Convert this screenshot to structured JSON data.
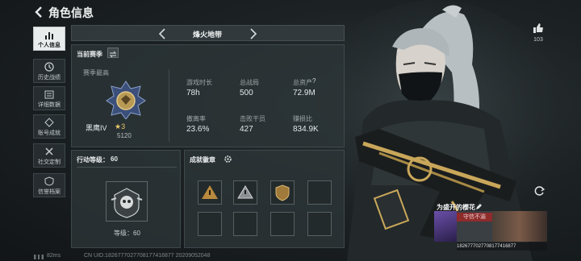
{
  "header": {
    "title": "角色信息"
  },
  "sidebar": {
    "items": [
      {
        "label": "个人信息",
        "icon": "bar-chart-icon",
        "active": true
      },
      {
        "label": "历史战绩",
        "icon": "history-icon"
      },
      {
        "label": "详细数据",
        "icon": "data-list-icon"
      },
      {
        "label": "账号成就",
        "icon": "achievement-icon"
      },
      {
        "label": "社交定制",
        "icon": "tools-icon"
      },
      {
        "label": "信誉档案",
        "icon": "credit-icon"
      }
    ]
  },
  "map_selector": {
    "name": "烽火地带"
  },
  "season": {
    "label": "当前赛季",
    "best_label": "赛季最高",
    "rank_name": "黑鹰IV",
    "rank_stars": "★3",
    "rank_points": "5120",
    "stats": [
      {
        "label": "游戏时长",
        "value": "78h"
      },
      {
        "label": "总战局",
        "value": "500"
      },
      {
        "label": "总资产",
        "value": "72.9M",
        "help": "?"
      },
      {
        "label": "撤离率",
        "value": "23.6%"
      },
      {
        "label": "击败干员",
        "value": "427"
      },
      {
        "label": "赚损比",
        "value": "834.9K"
      }
    ]
  },
  "action_level": {
    "title": "行动等级：",
    "level": "60",
    "footer": "等级：60"
  },
  "badges": {
    "title": "成就徽章"
  },
  "likes": {
    "count": "103"
  },
  "player": {
    "nickname": "为盛开的樱花",
    "tag": "守信不渝",
    "uid": "1826777027708177416877"
  },
  "footer": {
    "ping": "82ms",
    "uid_line": "CN UID:1826777027708177416877 20209052048"
  },
  "colors": {
    "panel": "#2c3437",
    "accent_gold": "#c9a75a",
    "tag_red": "#8e2b2b"
  }
}
